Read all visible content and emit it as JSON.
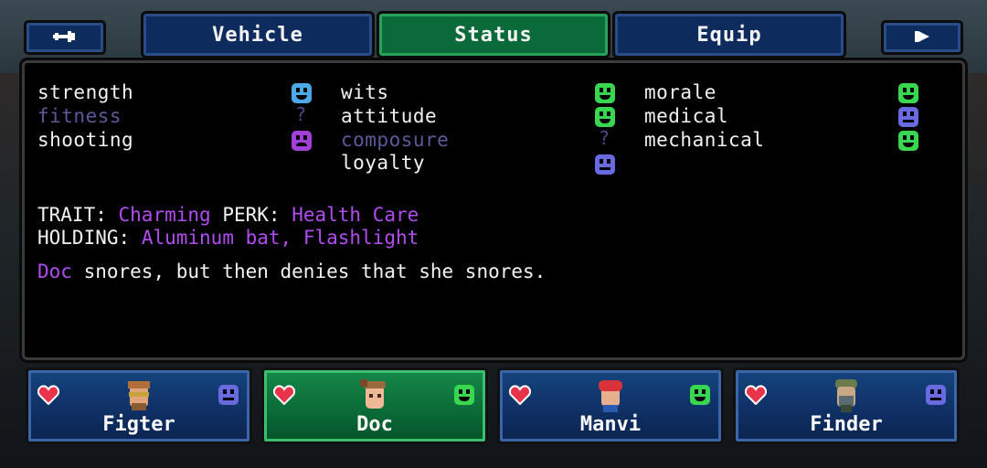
{
  "nav": {
    "tabs": [
      {
        "label": "Vehicle"
      },
      {
        "label": "Status"
      },
      {
        "label": "Equip"
      }
    ],
    "active_tab": "Status",
    "left_icon": "exit-icon",
    "right_icon": "next-arrow-icon"
  },
  "stats": {
    "col1": [
      {
        "label": "strength",
        "mood": "happy",
        "color": "#4ea8e6"
      },
      {
        "label": "fitness",
        "mood": "unknown",
        "color": "#5a5a9a"
      },
      {
        "label": "shooting",
        "mood": "sad",
        "color": "#a040d8"
      }
    ],
    "col2": [
      {
        "label": "wits",
        "mood": "happy",
        "color": "#39d650"
      },
      {
        "label": "attitude",
        "mood": "happy",
        "color": "#39d650"
      },
      {
        "label": "composure",
        "mood": "unknown",
        "color": "#5a5a9a"
      },
      {
        "label": "loyalty",
        "mood": "neutral",
        "color": "#6a6ae0"
      }
    ],
    "col3": [
      {
        "label": "morale",
        "mood": "happy",
        "color": "#39d650"
      },
      {
        "label": "medical",
        "mood": "neutral",
        "color": "#6a6ae0"
      },
      {
        "label": "mechanical",
        "mood": "happy",
        "color": "#39d650"
      }
    ],
    "unknown_mark": "?"
  },
  "info": {
    "trait_label": "TRAIT:",
    "trait_value": "Charming",
    "perk_label": "PERK:",
    "perk_value": "Health Care",
    "holding_label": "HOLDING:",
    "holding_value": "Aluminum bat, Flashlight",
    "note_name": "Doc",
    "note_text": " snores, but then denies that she snores."
  },
  "party": [
    {
      "name": "Figter",
      "mood": "neutral",
      "active": false
    },
    {
      "name": "Doc",
      "mood": "happy",
      "active": true
    },
    {
      "name": "Manvi",
      "mood": "happy",
      "active": false
    },
    {
      "name": "Finder",
      "mood": "neutral",
      "active": false
    }
  ],
  "colors": {
    "purple_text": "#b14cf0",
    "heart": "#e8344a",
    "tab_blue": "#0e2b5e",
    "tab_green": "#0a6a3a"
  }
}
